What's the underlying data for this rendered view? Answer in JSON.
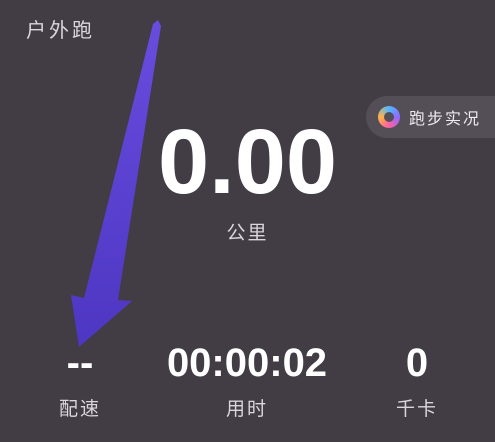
{
  "header": {
    "title": "户外跑"
  },
  "live_chip": {
    "label": "跑步实况",
    "icon": "ring-icon"
  },
  "distance": {
    "value": "0.00",
    "unit": "公里"
  },
  "stats": {
    "pace": {
      "value": "--",
      "label": "配速"
    },
    "duration": {
      "value": "00:00:02",
      "label": "用时"
    },
    "calories": {
      "value": "0",
      "label": "千卡"
    }
  },
  "colors": {
    "background": "#423c45",
    "chip_background": "#544e57",
    "arrow": "#5a3fd6"
  }
}
